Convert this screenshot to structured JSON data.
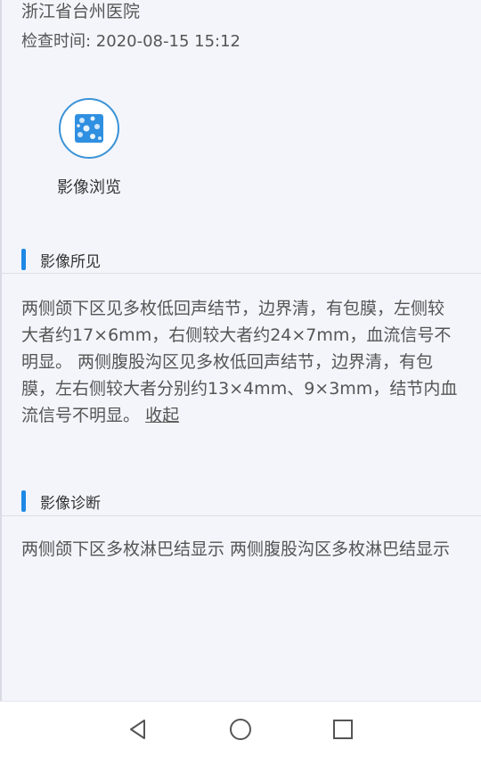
{
  "header": {
    "hospital": "浙江省台州医院",
    "exam_time": "检查时间: 2020-08-15 15:12"
  },
  "viewer": {
    "label": "影像浏览",
    "icon": "image-viewer-icon"
  },
  "findings": {
    "title": "影像所见",
    "text": "两侧颌下区见多枚低回声结节，边界清，有包膜，左侧较大者约17×6mm，右侧较大者约24×7mm，血流信号不明显。 两侧腹股沟区见多枚低回声结节，边界清，有包膜，左右侧较大者分别约13×4mm、9×3mm，结节内血流信号不明显。",
    "collapse_label": "收起"
  },
  "diagnosis": {
    "title": "影像诊断",
    "text": "两侧颌下区多枚淋巴结显示 两侧腹股沟区多枚淋巴结显示"
  },
  "navbar": {
    "back_icon": "back-triangle-icon",
    "home_icon": "home-circle-icon",
    "recents_icon": "recents-square-icon"
  },
  "colors": {
    "accent": "#1e88e5",
    "background": "#f3f5fb"
  }
}
